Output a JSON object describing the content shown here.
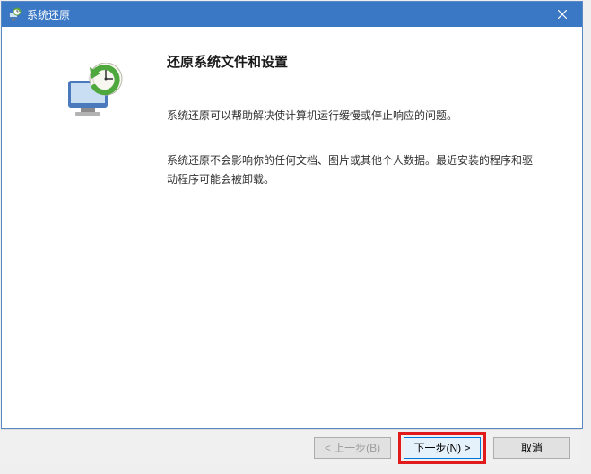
{
  "titlebar": {
    "title": "系统还原"
  },
  "content": {
    "heading": "还原系统文件和设置",
    "paragraph1": "系统还原可以帮助解决使计算机运行缓慢或停止响应的问题。",
    "paragraph2": "系统还原不会影响你的任何文档、图片或其他个人数据。最近安装的程序和驱动程序可能会被卸载。"
  },
  "footer": {
    "back_label": "< 上一步(B)",
    "next_label": "下一步(N) >",
    "cancel_label": "取消"
  }
}
